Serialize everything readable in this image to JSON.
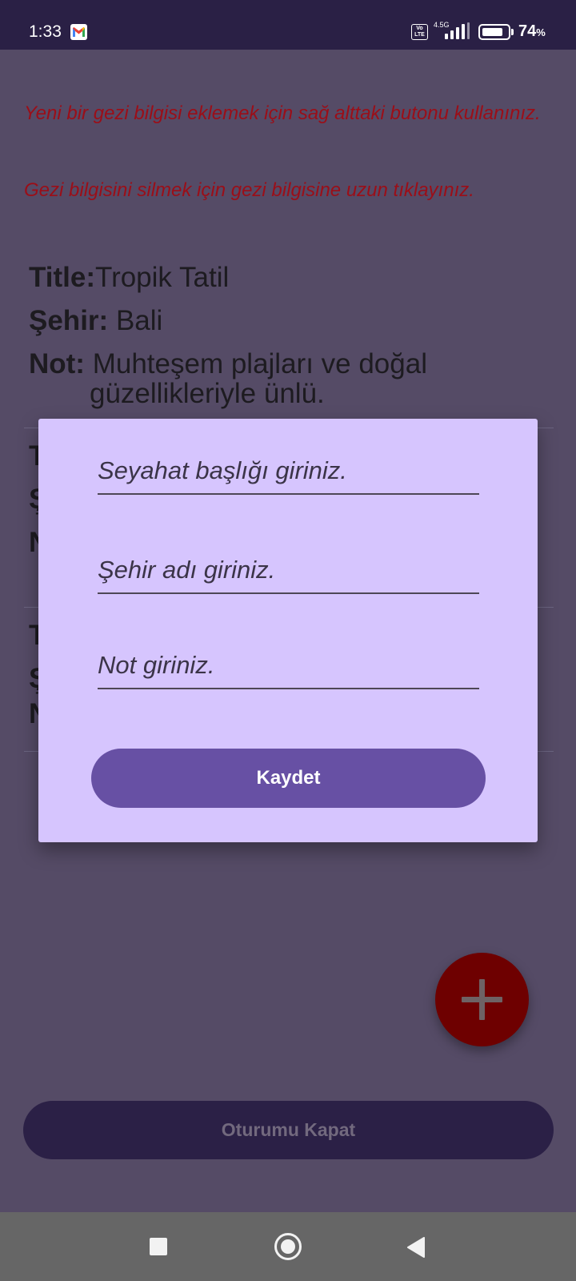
{
  "status_bar": {
    "time": "1:33",
    "network_type": "4.5G",
    "volte_label": "Vo\nLTE",
    "battery_percent": "74",
    "battery_unit": "%",
    "icons": [
      "gmail-icon",
      "volte-icon",
      "signal-icon",
      "battery-icon"
    ]
  },
  "hints": {
    "add_hint": "Yeni bir gezi bilgisi eklemek için sağ alttaki butonu kullanınız.",
    "delete_hint": "Gezi bilgisini silmek için gezi bilgisine uzun tıklayınız."
  },
  "trips": [
    {
      "title_key": "Title:",
      "title_value": "Tropik Tatil",
      "city_key": "Şehir:",
      "city_value": "Bali",
      "note_key": "Not:",
      "note_line1": "Muhteşem plajları ve doğal",
      "note_line2": "güzellikleriyle ünlü."
    },
    {
      "title_key": "T",
      "city_key": "Ş",
      "note_key": "N"
    },
    {
      "title_key": "T",
      "city_key": "Ş",
      "note_key": "N"
    }
  ],
  "dialog": {
    "title_placeholder": "Seyahat başlığı giriniz.",
    "city_placeholder": "Şehir adı giriniz.",
    "note_placeholder": "Not giriniz.",
    "save_label": "Kaydet"
  },
  "fab": {
    "icon": "plus-icon"
  },
  "logout_label": "Oturumu Kapat",
  "nav_bar": {
    "icons": [
      "recents-icon",
      "home-icon",
      "back-icon"
    ]
  },
  "colors": {
    "hint_text": "#9b0e18",
    "dialog_bg": "#d6c5fe",
    "primary": "#6750a4",
    "fab": "#6e0000",
    "status_bar": "#2a2045"
  }
}
